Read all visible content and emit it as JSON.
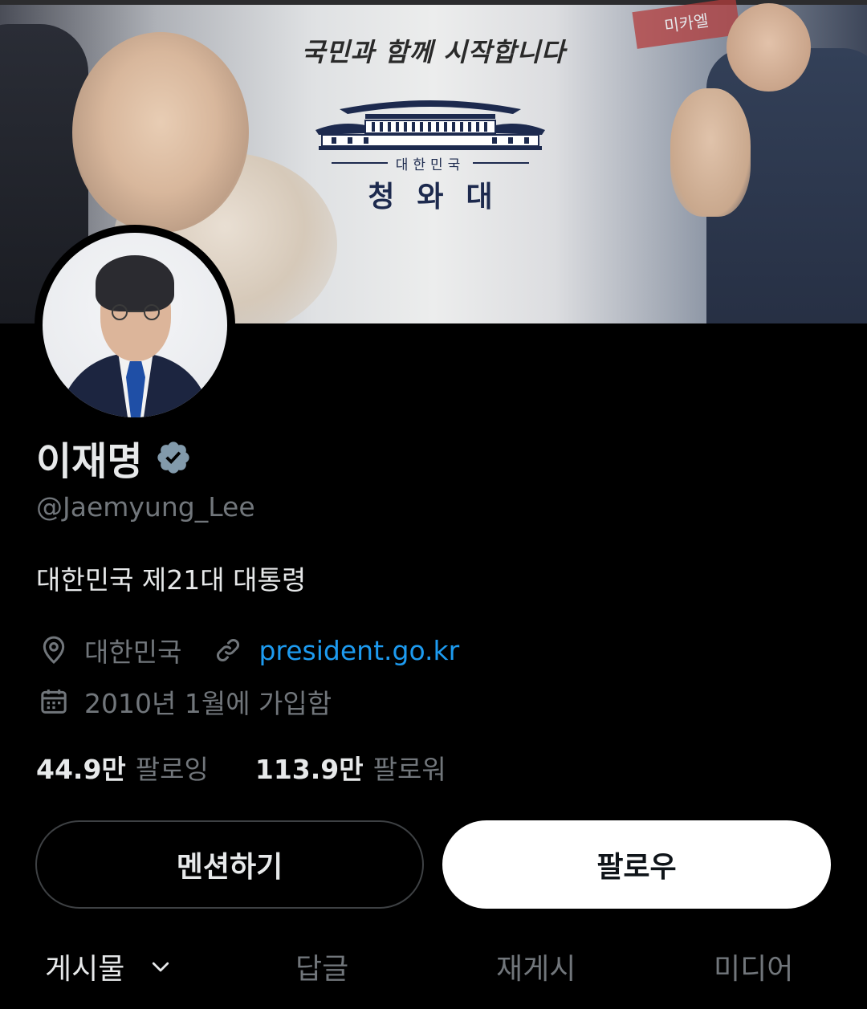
{
  "banner": {
    "slogan": "국민과 함께 시작합니다",
    "country": "대한민국",
    "office": "청와대",
    "sign_text": "미카엘"
  },
  "profile": {
    "name": "이재명",
    "handle": "@Jaemyung_Lee",
    "bio": "대한민국 제21대 대통령",
    "location": "대한민국",
    "website": "president.go.kr",
    "joined": "2010년 1월에 가입함",
    "following_count": "44.9만",
    "following_label": "팔로잉",
    "followers_count": "113.9만",
    "followers_label": "팔로워"
  },
  "actions": {
    "mention_label": "멘션하기",
    "follow_label": "팔로우"
  },
  "tabs": [
    {
      "label": "게시물",
      "active": true
    },
    {
      "label": "답글",
      "active": false
    },
    {
      "label": "재게시",
      "active": false
    },
    {
      "label": "미디어",
      "active": false
    }
  ],
  "colors": {
    "background": "#000000",
    "primary_text": "#e7e9ea",
    "secondary_text": "#71767b",
    "link": "#1d9bf0",
    "verified_badge": "#829aab"
  },
  "icons": {
    "verified": "verified-badge-icon",
    "location": "location-pin-icon",
    "website": "link-icon",
    "joined": "calendar-icon",
    "tab_dropdown": "chevron-down-icon"
  }
}
